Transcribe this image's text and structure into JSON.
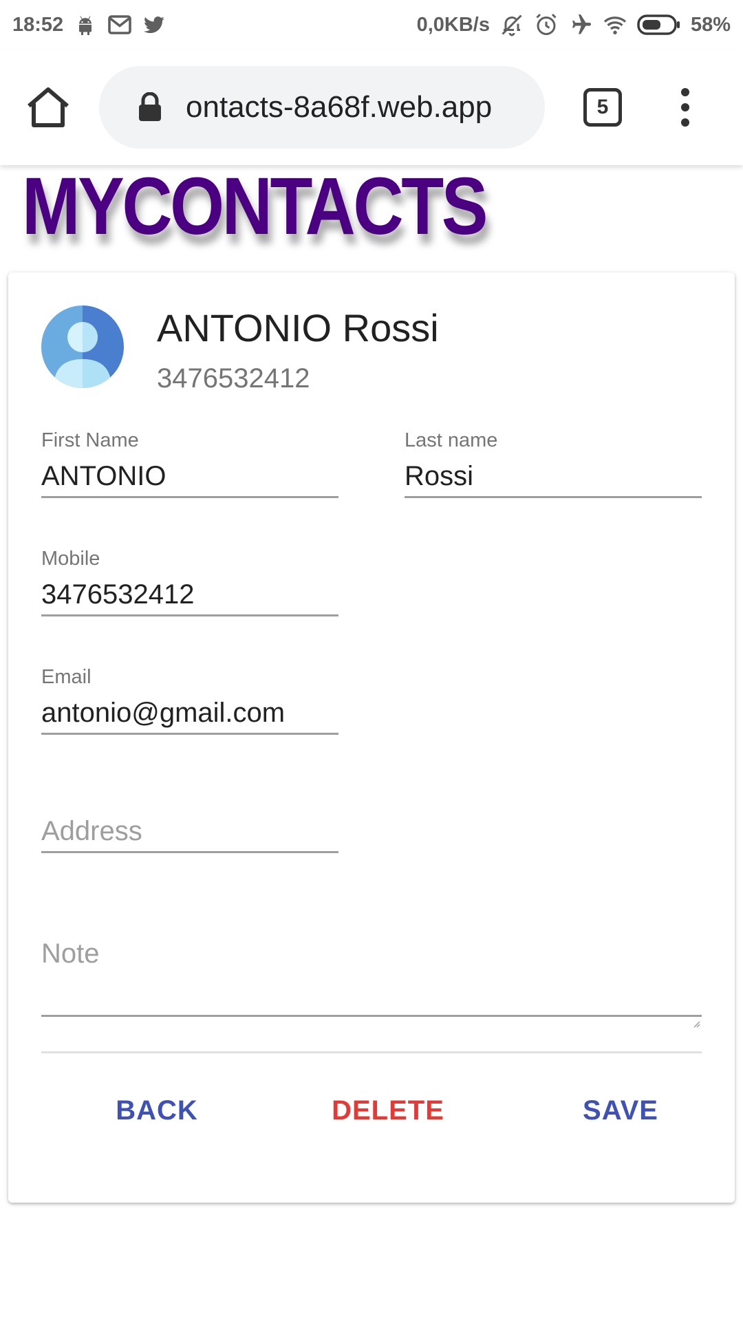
{
  "status_bar": {
    "time": "18:52",
    "net_speed": "0,0KB/s",
    "battery_percent": "58%",
    "battery_level": 0.58,
    "left_icons": [
      "android-icon",
      "gmail-icon",
      "twitter-icon"
    ],
    "right_icons": [
      "mute-icon",
      "alarm-icon",
      "airplane-icon",
      "wifi-icon",
      "battery-icon"
    ]
  },
  "browser": {
    "url": "ontacts-8a68f.web.app",
    "tab_count": "5"
  },
  "app": {
    "title": "MYCONTACTS",
    "title_color": "#4b0082"
  },
  "contact": {
    "header_name": "ANTONIO Rossi",
    "header_phone": "3476532412",
    "fields": {
      "first_name": {
        "label": "First Name",
        "value": "ANTONIO"
      },
      "last_name": {
        "label": "Last name",
        "value": "Rossi"
      },
      "mobile": {
        "label": "Mobile",
        "value": "3476532412"
      },
      "email": {
        "label": "Email",
        "value": "antonio@gmail.com"
      },
      "address": {
        "placeholder": "Address"
      },
      "note": {
        "placeholder": "Note"
      }
    }
  },
  "actions": {
    "back": "BACK",
    "delete": "DELETE",
    "save": "SAVE",
    "primary_color": "#3f51b5",
    "danger_color": "#e53935"
  }
}
